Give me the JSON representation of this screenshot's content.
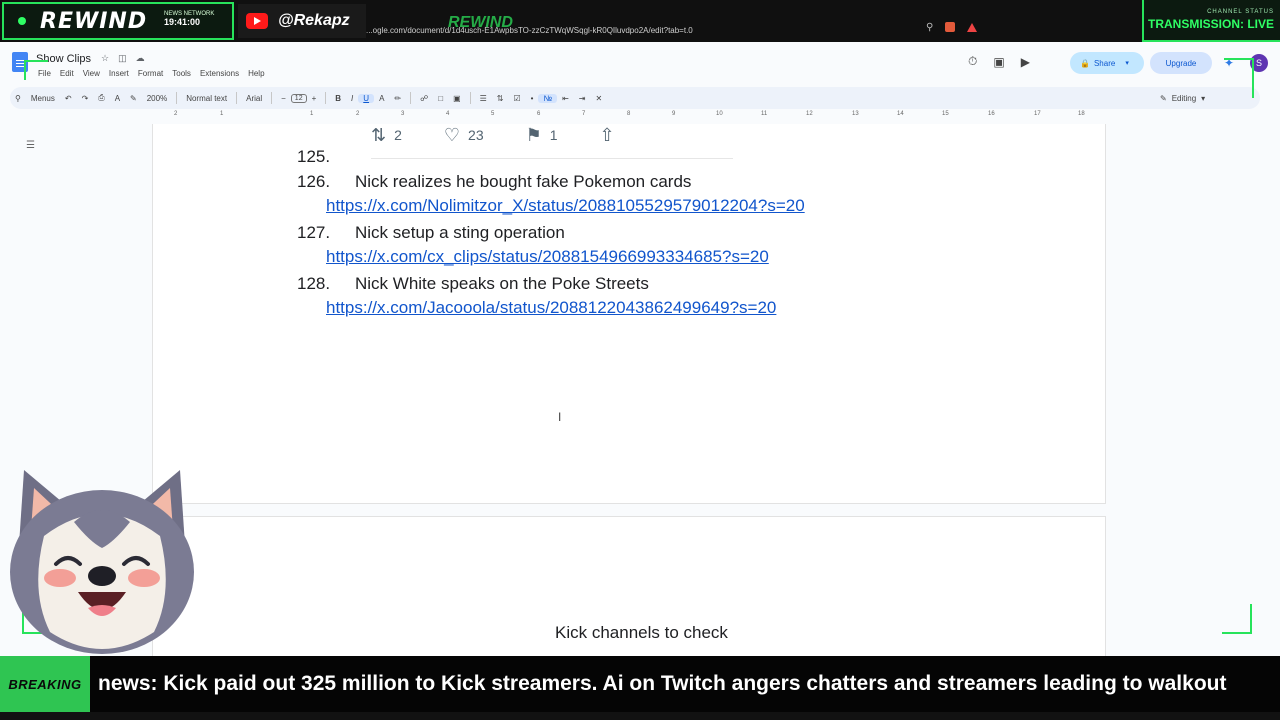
{
  "overlay": {
    "logo": "REWIND",
    "network_label": "NEWS NETWORK",
    "clock": "19:41:00",
    "handle": "@Rekapz",
    "faded_logo": "REWIND",
    "status_label": "CHANNEL STATUS",
    "status_value": "TRANSMISSION: LIVE",
    "accent_color": "#2fff65"
  },
  "browser": {
    "url": "...ogle.com/document/d/1d4usch-E1AwpbsTO-zzCzTWqWSqgl-kR0QIluvdpo2A/edit?tab=t.0"
  },
  "docs": {
    "title": "Show Clips",
    "menus": [
      "File",
      "Edit",
      "View",
      "Insert",
      "Format",
      "Tools",
      "Extensions",
      "Help"
    ],
    "share_label": "Share",
    "upgrade_label": "Upgrade",
    "avatar_letter": "S",
    "toolbar": {
      "search_label": "Menus",
      "zoom": "200%",
      "style": "Normal text",
      "font": "Arial",
      "font_size": "12",
      "mode": "Editing"
    },
    "ruler_marks": [
      "2",
      "1",
      "1",
      "2",
      "3",
      "4",
      "5",
      "6",
      "7",
      "8",
      "9",
      "10",
      "11",
      "12",
      "13",
      "14",
      "15",
      "16",
      "17",
      "18"
    ]
  },
  "tweet": {
    "retweets": "2",
    "likes": "23",
    "bookmarks": "1"
  },
  "entries": [
    {
      "num": "125.",
      "title": "",
      "link": ""
    },
    {
      "num": "126.",
      "title": "Nick realizes he bought fake Pokemon cards",
      "link": "https://x.com/Nolimitzor_X/status/2088105529579012204?s=20"
    },
    {
      "num": "127.",
      "title": "Nick setup a sting operation",
      "link": "https://x.com/cx_clips/status/2088154966993334685?s=20"
    },
    {
      "num": "128.",
      "title": "Nick White speaks on the Poke Streets",
      "link": "https://x.com/Jacooola/status/2088122043862499649?s=20"
    }
  ],
  "page2_text": "Kick channels to check",
  "ticker": {
    "label": "BREAKING",
    "text": "news: Kick paid out 325 million to Kick streamers. Ai on Twitch angers chatters and streamers leading to walkout"
  }
}
